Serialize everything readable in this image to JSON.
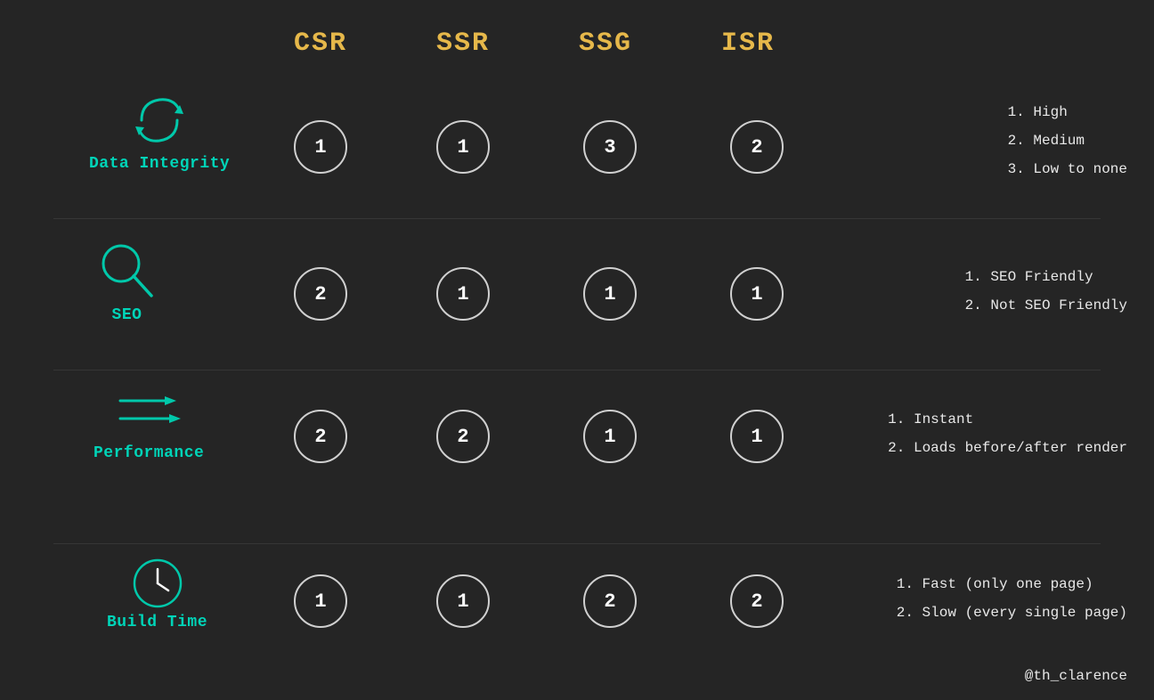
{
  "background_color": "#252525",
  "columns": {
    "csr": {
      "label": "CSR",
      "color": "#e6b84a"
    },
    "ssr": {
      "label": "SSR",
      "color": "#e6b84a"
    },
    "ssg": {
      "label": "SSG",
      "color": "#e6b84a"
    },
    "isr": {
      "label": "ISR",
      "color": "#e6b84a"
    }
  },
  "rows": [
    {
      "id": "data-integrity",
      "label": "Data Integrity",
      "icon": "sync",
      "color": "#00d4b8",
      "csr": "1",
      "ssr": "1",
      "ssg": "3",
      "isr": "2",
      "legend": [
        "1. High",
        "2. Medium",
        "3. Low to none"
      ]
    },
    {
      "id": "seo",
      "label": "SEO",
      "icon": "search",
      "color": "#00d4b8",
      "csr": "2",
      "ssr": "1",
      "ssg": "1",
      "isr": "1",
      "legend": [
        "1. SEO Friendly",
        "2. Not SEO Friendly"
      ]
    },
    {
      "id": "performance",
      "label": "Performance",
      "icon": "arrows",
      "color": "#00d4b8",
      "csr": "2",
      "ssr": "2",
      "ssg": "1",
      "isr": "1",
      "legend": [
        "1. Instant",
        "2. Loads before/after render"
      ]
    },
    {
      "id": "build-time",
      "label": "Build Time",
      "icon": "clock",
      "color": "#00d4b8",
      "csr": "1",
      "ssr": "1",
      "ssg": "2",
      "isr": "2",
      "legend": [
        "1. Fast (only one page)",
        "2. Slow (every single page)"
      ]
    }
  ],
  "watermark": "@th_clarence"
}
